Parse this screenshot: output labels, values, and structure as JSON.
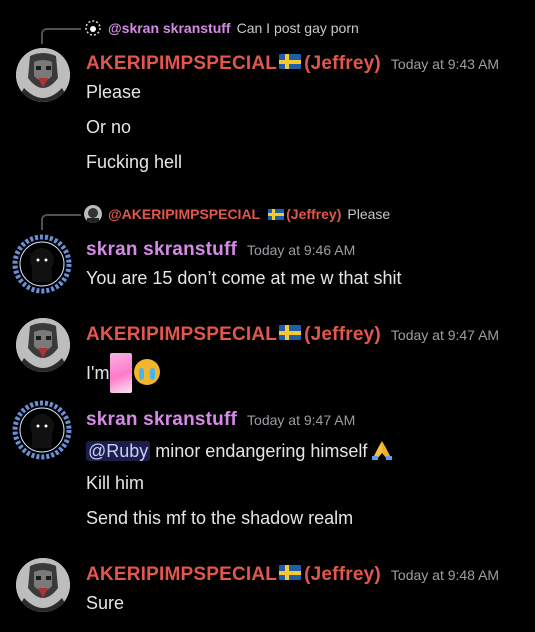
{
  "colors": {
    "background": "#000000",
    "jeffrey_name": "#e2574c",
    "skran_name": "#d58be6",
    "timestamp": "#9b9ea4",
    "mention_bg": "#5865f24d"
  },
  "messages": [
    {
      "reply": {
        "author": "@skran skranstuff",
        "text": "Can I post gay porn"
      },
      "author": "AKERIPIMPSPECIAL",
      "author_suffix": "(Jeffrey)",
      "flag_icon": "sweden-flag-icon",
      "timestamp": "Today at 9:43 AM",
      "lines": [
        "Please",
        "Or no",
        "Fucking hell"
      ]
    },
    {
      "reply": {
        "author": "@AKERIPIMPSPECIAL",
        "author_suffix": "(Jeffrey)",
        "text": "Please"
      },
      "author": "skran skranstuff",
      "timestamp": "Today at 9:46 AM",
      "lines": [
        "You are 15 don’t come at me w that shit"
      ]
    },
    {
      "author": "AKERIPIMPSPECIAL",
      "author_suffix": "(Jeffrey)",
      "flag_icon": "sweden-flag-icon",
      "timestamp": "Today at 9:47 AM",
      "lines": [
        "I'm"
      ],
      "emojis": [
        "sticker-emoji",
        "loudly-crying-face-icon"
      ]
    },
    {
      "author": "skran skranstuff",
      "timestamp": "Today at 9:47 AM",
      "mention": "@Ruby",
      "lines": [
        " minor endangering himself",
        "Kill him",
        "Send this mf to the shadow realm"
      ],
      "emojis": [
        "folded-hands-icon"
      ]
    },
    {
      "author": "AKERIPIMPSPECIAL",
      "author_suffix": "(Jeffrey)",
      "flag_icon": "sweden-flag-icon",
      "timestamp": "Today at 9:48 AM",
      "lines": [
        "Sure"
      ]
    }
  ]
}
